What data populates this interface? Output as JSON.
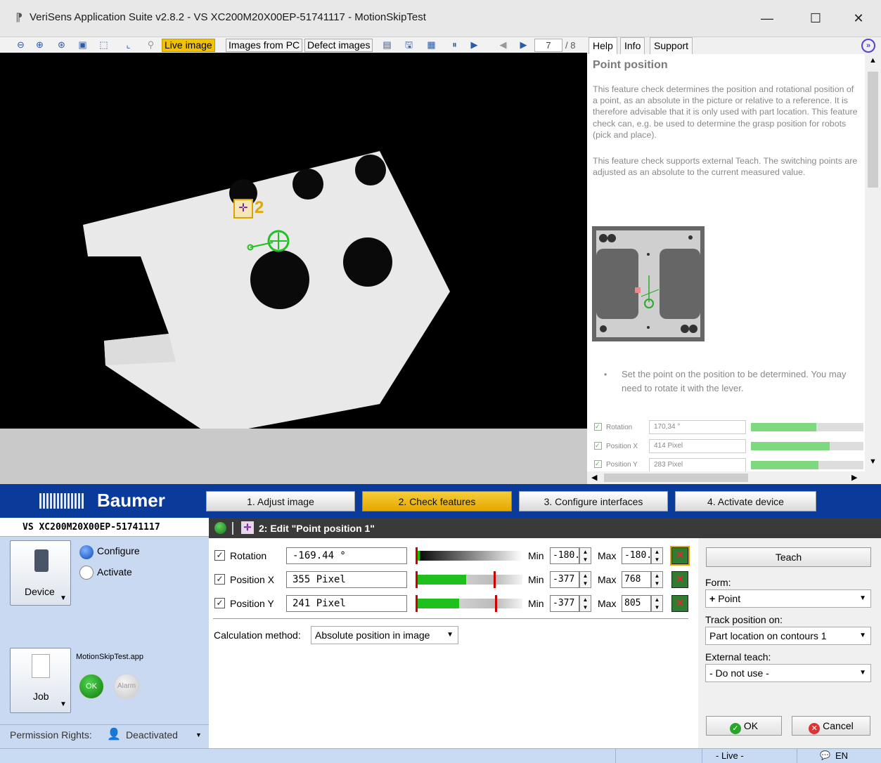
{
  "window": {
    "title": "VeriSens Application Suite v2.8.2 - VS XC200M20X00EP-51741117 - MotionSkipTest"
  },
  "toolbar": {
    "live_image": "Live image",
    "images_from_pc": "Images from PC",
    "defect_images": "Defect images",
    "frame_current": "7",
    "frame_total": "/ 8"
  },
  "overlay": {
    "marker_label": "2"
  },
  "help": {
    "tabs": [
      "Help",
      "Info",
      "Support"
    ],
    "title": "Point position",
    "para1": "This feature check determines the position and rotational position of a point, as an absolute in the picture or relative to a reference. It is therefore advisable that it is only used with part location. This feature check can, e.g. be used to determine the grasp position for robots (pick and place).",
    "para2": "This feature check supports external Teach. The switching points are adjusted as an absolute to the current measured value.",
    "bullet": "Set the point on the position to be determined. You may need to rotate it with the lever.",
    "mini_rows": [
      {
        "label": "Rotation",
        "value": "170,34 °"
      },
      {
        "label": "Position X",
        "value": "414 Pixel"
      },
      {
        "label": "Position Y",
        "value": "283 Pixel"
      }
    ]
  },
  "brand": "Baumer",
  "steps": [
    "1. Adjust image",
    "2. Check features",
    "3. Configure interfaces",
    "4. Activate device"
  ],
  "device": {
    "name": "VS XC200M20X00EP-51741117",
    "configure": "Configure",
    "activate": "Activate",
    "device_label": "Device",
    "job_label": "Job",
    "job_file": "MotionSkipTest.app",
    "ok_label": "OK",
    "alarm_label": "Alarm",
    "permission_label": "Permission Rights:",
    "permission_value": "Deactivated"
  },
  "editor": {
    "title": "2: Edit \"Point position 1\"",
    "rows": [
      {
        "label": "Rotation",
        "value": "-169.44 °",
        "min": "-180.0",
        "max": "-180.0",
        "checked": true
      },
      {
        "label": "Position X",
        "value": "355 Pixel",
        "min": "-377",
        "max": "768",
        "checked": true
      },
      {
        "label": "Position Y",
        "value": "241 Pixel",
        "min": "-377",
        "max": "805",
        "checked": true
      }
    ],
    "min_label": "Min",
    "max_label": "Max",
    "calc_label": "Calculation method:",
    "calc_value": "Absolute position in image"
  },
  "right": {
    "teach": "Teach",
    "form_label": "Form:",
    "form_value": "Point",
    "track_label": "Track position on:",
    "track_value": "Part location on contours 1",
    "ext_label": "External teach:",
    "ext_value": "- Do not use -",
    "ok": "OK",
    "cancel": "Cancel"
  },
  "status": {
    "mode": "- Live -",
    "lang": "EN"
  }
}
